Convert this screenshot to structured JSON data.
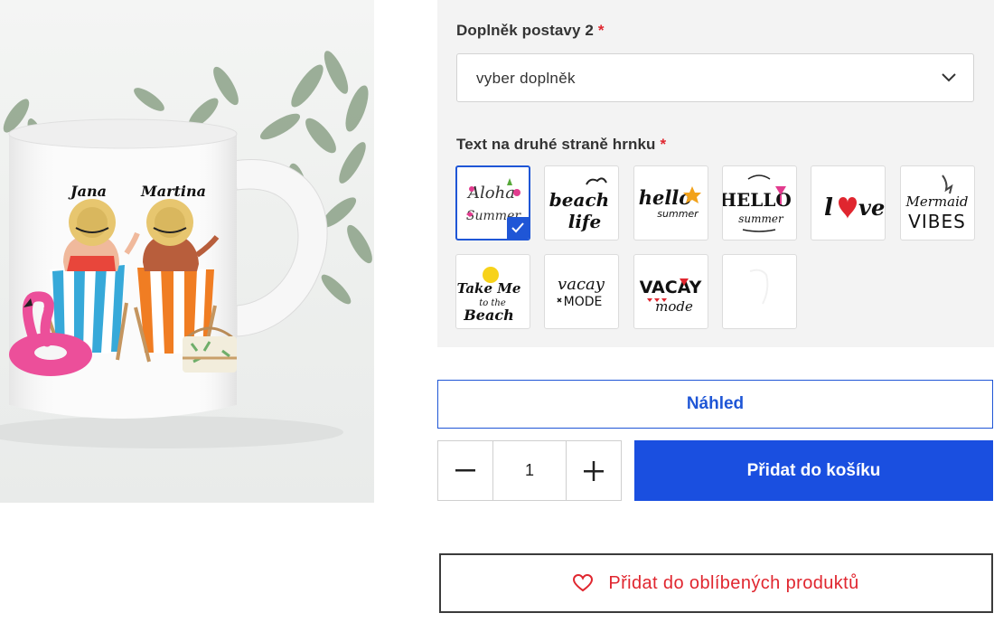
{
  "product": {
    "names": [
      "Jana",
      "Martina"
    ]
  },
  "options": {
    "accessory_label": "Doplněk postavy 2",
    "required_mark": "*",
    "accessory_select_value": "vyber doplněk",
    "back_text_label": "Text na druhé straně hrnku",
    "back_text_required_mark": "*",
    "designs": [
      {
        "text": "Aloha Summer",
        "selected": true
      },
      {
        "text": "beach life",
        "selected": false
      },
      {
        "text": "hello summer",
        "selected": false
      },
      {
        "text": "HELLO summer",
        "selected": false
      },
      {
        "text": "love",
        "selected": false
      },
      {
        "text": "Mermaid VIBES",
        "selected": false
      },
      {
        "text": "Take Me to the Beach",
        "selected": false
      },
      {
        "text": "vacay MODE",
        "selected": false
      },
      {
        "text": "VACAY mode",
        "selected": false
      },
      {
        "text": "",
        "selected": false
      }
    ]
  },
  "actions": {
    "preview_label": "Náhled",
    "quantity": "1",
    "add_to_cart_label": "Přidat do košíku",
    "add_to_favorites_label": "Přidat do oblíbených produktů"
  },
  "colors": {
    "accent": "#1f56d6",
    "cart_button": "#1a4fe0",
    "favorites_red": "#e0262f",
    "panel_bg": "#f3f3f3"
  }
}
